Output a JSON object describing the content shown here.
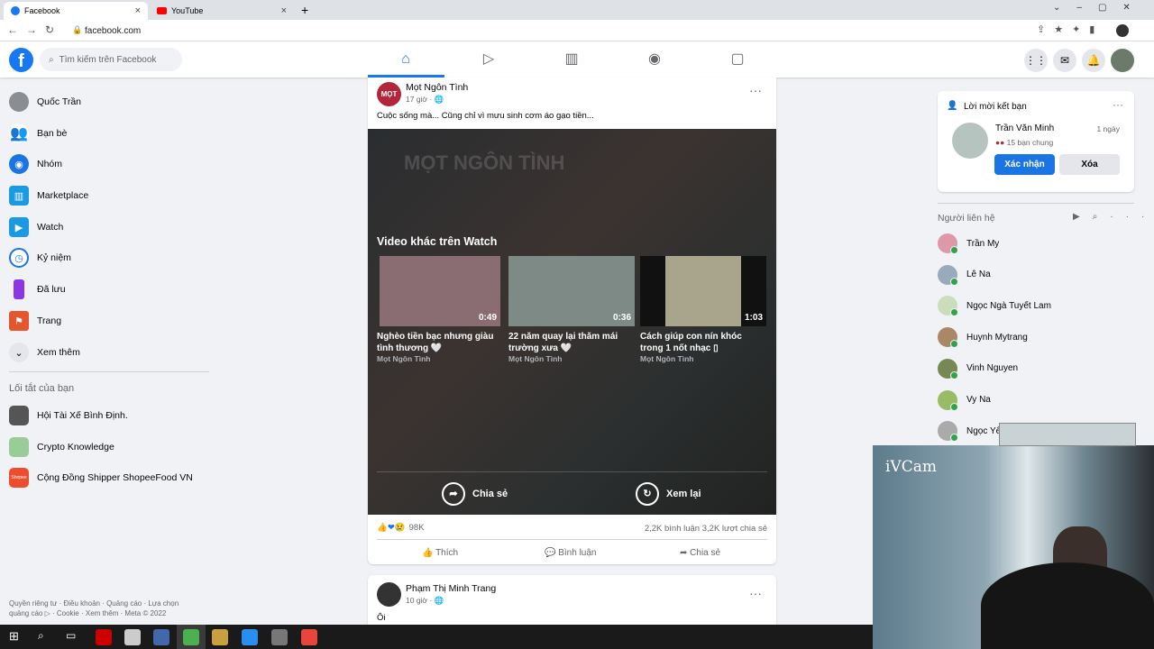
{
  "browser": {
    "tabs": [
      {
        "label": "Facebook",
        "icon": "facebook-icon"
      },
      {
        "label": "YouTube",
        "icon": "youtube-icon"
      }
    ],
    "url": "facebook.com"
  },
  "header": {
    "search_placeholder": "Tìm kiếm trên Facebook",
    "nav": [
      "home-icon",
      "watch-icon",
      "marketplace-icon",
      "groups-icon",
      "gaming-icon"
    ]
  },
  "sidebar": {
    "items": [
      {
        "label": "Quốc Trần",
        "color": "#8a8d91"
      },
      {
        "label": "Bạn bè",
        "color": "#1b74e4"
      },
      {
        "label": "Nhóm",
        "color": "#1b74e4"
      },
      {
        "label": "Marketplace",
        "color": "#1b9ae4"
      },
      {
        "label": "Watch",
        "color": "#1b9ae4"
      },
      {
        "label": "Kỷ niệm",
        "color": "#1b74e4"
      },
      {
        "label": "Đã lưu",
        "color": "#8b35e4"
      },
      {
        "label": "Trang",
        "color": "#e4572e"
      },
      {
        "label": "Xem thêm",
        "color": "#e4e6eb"
      }
    ],
    "shortcuts_title": "Lối tắt của bạn",
    "shortcuts": [
      {
        "label": "Hội Tài Xế Bình Định."
      },
      {
        "label": "Crypto Knowledge"
      },
      {
        "label": "Cộng Đồng Shipper ShopeeFood VN"
      }
    ],
    "footer1": "Quyền riêng tư · Điều khoản · Quảng cáo · Lựa chọn",
    "footer2": "quảng cáo ▷ · Cookie · Xem thêm · Meta © 2022"
  },
  "post": {
    "author": "Mọt Ngôn Tình",
    "time": "17 giờ ·",
    "text": "Cuộc sống mà... Cũng chỉ vì mưu sinh cơm áo gạo tiền...",
    "watermark": "MỌT NGÔN TÌNH",
    "more_title": "Video khác trên Watch",
    "videos": [
      {
        "title": "Nghèo tiền bạc nhưng giàu tình thương 🤍",
        "source": "Mọt Ngôn Tình",
        "duration": "0:49"
      },
      {
        "title": "22 năm quay lại thăm mái trường xưa 🤍",
        "source": "Mọt Ngôn Tình",
        "duration": "0:36"
      },
      {
        "title": "Cách giúp con nín khóc trong 1 nốt nhạc ▯",
        "source": "Mọt Ngôn Tình",
        "duration": "1:03"
      }
    ],
    "share_label": "Chia sẻ",
    "replay_label": "Xem lại",
    "reactions": "98K",
    "comments": "2,2K bình luận",
    "shares": "3,2K lượt chia sẻ",
    "actions": [
      "Thích",
      "Bình luận",
      "Chia sẻ"
    ]
  },
  "post2": {
    "author": "Phạm Thị Minh Trang",
    "time": "10 giờ ·",
    "text": "Ôi"
  },
  "friend_request": {
    "title": "Lời mời kết bạn",
    "name": "Trần Văn Minh",
    "time": "1 ngày",
    "mutual": "15 bạn chung",
    "confirm": "Xác nhận",
    "delete": "Xóa"
  },
  "contacts": {
    "title": "Người liên hệ",
    "items": [
      "Trần My",
      "Lê Na",
      "Ngọc Ngà Tuyết Lam",
      "Huynh Mytrang",
      "Vinh Nguyen",
      "Vy Na",
      "Ngọc Yến"
    ]
  },
  "webcam": {
    "label": "iVCam"
  },
  "colors": {
    "accent": "#1b74e4",
    "bg": "#f0f2f5"
  }
}
